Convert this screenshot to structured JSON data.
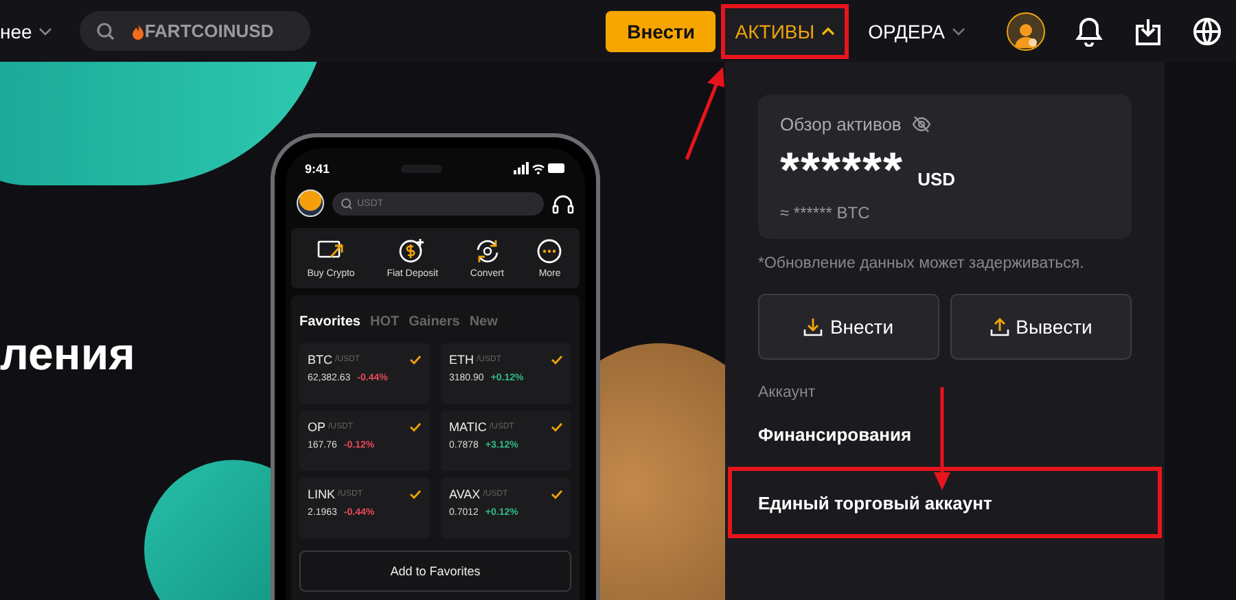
{
  "header": {
    "nav_partial": "нее",
    "search": {
      "value": "FARTCOINUSD"
    },
    "deposit_button": "Внести",
    "menus": [
      {
        "label": "АКТИВЫ",
        "expanded": true,
        "highlighted": true
      },
      {
        "label": "ОРДЕРА",
        "expanded": false,
        "highlighted": false
      }
    ]
  },
  "hero": {
    "heading_partial": "ления"
  },
  "phone": {
    "time": "9:41",
    "search_placeholder": "USDT",
    "actions": [
      {
        "label": "Buy Crypto",
        "kind": "card"
      },
      {
        "label": "Fiat Deposit",
        "kind": "dollar"
      },
      {
        "label": "Convert",
        "kind": "convert"
      },
      {
        "label": "More",
        "kind": "more"
      }
    ],
    "tabs": [
      {
        "label": "Favorites",
        "selected": true
      },
      {
        "label": "HOT",
        "selected": false
      },
      {
        "label": "Gainers",
        "selected": false
      },
      {
        "label": "New",
        "selected": false
      }
    ],
    "pairs": [
      {
        "base": "BTC",
        "quote": "/USDT",
        "price": "62,382.63",
        "change": "-0.44%",
        "color": "#e84a5a",
        "favorite": true
      },
      {
        "base": "ETH",
        "quote": "/USDT",
        "price": "3180.90",
        "change": "+0.12%",
        "color": "#2ebd85",
        "favorite": true
      },
      {
        "base": "OP",
        "quote": "/USDT",
        "price": "167.76",
        "change": "-0.12%",
        "color": "#e84a5a",
        "favorite": true
      },
      {
        "base": "MATIC",
        "quote": "/USDT",
        "price": "0.7878",
        "change": "+3.12%",
        "color": "#2ebd85",
        "favorite": true
      },
      {
        "base": "LINK",
        "quote": "/USDT",
        "price": "2.1963",
        "change": "-0.44%",
        "color": "#e84a5a",
        "favorite": true
      },
      {
        "base": "AVAX",
        "quote": "/USDT",
        "price": "0.7012",
        "change": "+0.12%",
        "color": "#2ebd85",
        "favorite": true
      }
    ],
    "add_button": "Add to Favorites"
  },
  "assets_panel": {
    "title": "Обзор активов",
    "balance": "******",
    "currency": "USD",
    "approx": "≈ ****** BTC",
    "note": "*Обновление данных может задерживаться.",
    "buttons": [
      {
        "label": "Внести",
        "kind": "deposit"
      },
      {
        "label": "Вывести",
        "kind": "withdraw"
      }
    ],
    "section_label": "Аккаунт",
    "items": [
      {
        "label": "Финансирования",
        "highlighted": false
      },
      {
        "label": "Единый торговый аккаунт",
        "highlighted": true
      }
    ]
  }
}
